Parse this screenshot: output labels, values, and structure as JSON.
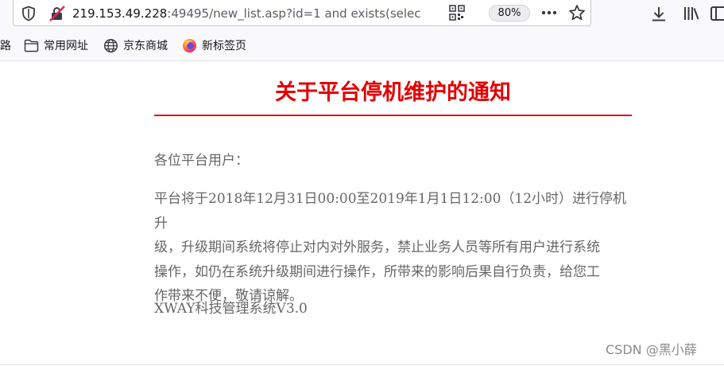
{
  "browser": {
    "url_host": "219.153.49.228",
    "url_rest": ":49495/new_list.asp?id=1 and exists(selec",
    "zoom": "80%",
    "icons": [
      "shield-icon",
      "insecure-lock-icon",
      "qr-code-icon",
      "more-icon",
      "bookmark-star-icon",
      "downloads-icon",
      "library-icon",
      "sidebar-icon"
    ]
  },
  "bookmarks": {
    "partial_item": "路",
    "items": [
      {
        "label": "常用网址",
        "icon": "folder-icon"
      },
      {
        "label": "京东商城",
        "icon": "globe-icon"
      },
      {
        "label": "新标签页",
        "icon": "firefox-icon"
      }
    ]
  },
  "notice": {
    "title": "关于平台停机维护的通知",
    "greeting": "各位平台用户：",
    "lines": [
      "平台将于2018年12月31日00:00至2019年1月1日12:00（12小时）进行停机升",
      "级，升级期间系统将停止对内对外服务，禁止业务人员等所有用户进行系统",
      "操作，如仍在系统升级期间进行操作，所带来的影响后果自行负责，给您工",
      "作带来不便，敬请谅解。"
    ],
    "signature": "XWAY科技管理系统V3.0"
  },
  "watermark": "CSDN @黑小薛",
  "colors": {
    "title": "#e30000",
    "rule": "#e01010",
    "body_text": "#666666"
  }
}
